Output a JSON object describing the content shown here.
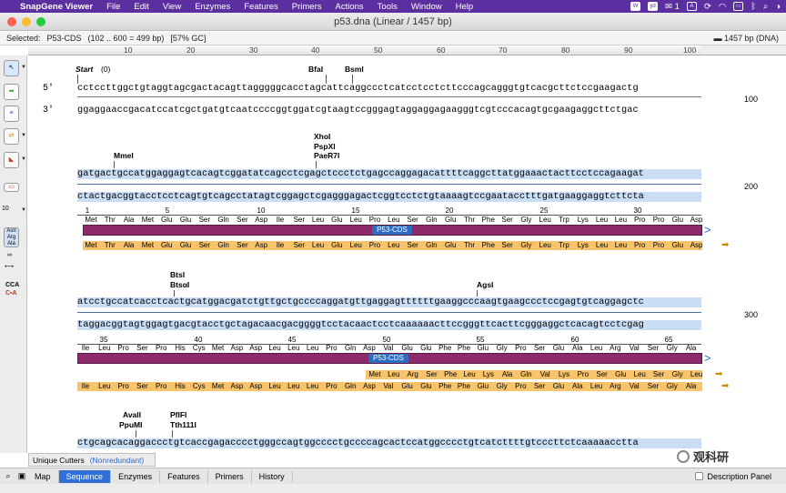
{
  "menubar": {
    "app_name": "SnapGene Viewer",
    "items": [
      "File",
      "Edit",
      "View",
      "Enzymes",
      "Features",
      "Primers",
      "Actions",
      "Tools",
      "Window",
      "Help"
    ],
    "wechat_count": "1"
  },
  "window": {
    "title": "p53.dna (Linear / 1457 bp)"
  },
  "selection": {
    "label": "Selected:",
    "feature": "P53-CDS",
    "range": "(102 .. 600  =  499 bp)",
    "gc": "[57% GC]",
    "length": "1457 bp  (DNA)"
  },
  "ruler_ticks": [
    "10",
    "20",
    "30",
    "40",
    "50",
    "60",
    "70",
    "80",
    "90",
    "100"
  ],
  "toolbar": {
    "tools": [
      "select-tool",
      "insert-arrow",
      "reverse-complement",
      "swap-strands",
      "protein-view",
      "feature-map"
    ],
    "enzyme_count": "10",
    "aa_labels": [
      "Asn",
      "Arg",
      "Ala"
    ],
    "infinity": "∞",
    "cca": "CCA"
  },
  "block1": {
    "start_label": "Start",
    "start_index": "(0)",
    "strand5": "5′",
    "strand3": "3′",
    "enzymes": [
      "BfaI",
      "BsmI"
    ],
    "top": "cctccttggctgtaggtagcgactacagttagggggcacctagcattcaggccctcatcctcctcttcccagcagggtgtcacgcttctccgaagactg",
    "bottom": "ggaggaaccgacatccatcgctgatgtcaatccccggtggatcgtaagtccgggagtaggaggagaagggtcgtcccacagtgcgaagaggcttctgac",
    "end": "100"
  },
  "block2": {
    "enzymes": [
      "MmeI",
      "XhoI",
      "PspXI",
      "PaeR7I"
    ],
    "top": "gatgactgccatggaggagtcacagtcggatatcagcctcgagctccctctgagccaggagacattttcaggcttatggaaactacttcctccagaagat",
    "bottom": "ctactgacggtacctcctcagtgtcagcctatagtcggagctcgagggagactcggtcctctgtaaaagtccgaatacctttgatgaaggaggtcttcta",
    "end": "200",
    "aa_numbers": [
      "1",
      "5",
      "10",
      "15",
      "20",
      "25",
      "30"
    ],
    "aa": [
      "Met",
      "Thr",
      "Ala",
      "Met",
      "Glu",
      "Glu",
      "Ser",
      "Gln",
      "Ser",
      "Asp",
      "Ile",
      "Ser",
      "Leu",
      "Glu",
      "Leu",
      "Pro",
      "Leu",
      "Ser",
      "Gln",
      "Glu",
      "Thr",
      "Phe",
      "Ser",
      "Gly",
      "Leu",
      "Trp",
      "Lys",
      "Leu",
      "Leu",
      "Pro",
      "Pro",
      "Glu",
      "Asp"
    ],
    "feature_label": "P53-CDS",
    "orf": [
      "Met",
      "Thr",
      "Ala",
      "Met",
      "Glu",
      "Glu",
      "Ser",
      "Gln",
      "Ser",
      "Asp",
      "Ile",
      "Ser",
      "Leu",
      "Glu",
      "Leu",
      "Pro",
      "Leu",
      "Ser",
      "Gln",
      "Glu",
      "Thr",
      "Phe",
      "Ser",
      "Gly",
      "Leu",
      "Trp",
      "Lys",
      "Leu",
      "Leu",
      "Pro",
      "Pro",
      "Glu",
      "Asp"
    ]
  },
  "block3": {
    "enzymes": [
      "BtsI",
      "BtsαI",
      "AgsI"
    ],
    "top": "atcctgccatcacctcactgcatggacgatctgttgctgccccaggatgttgaggagttttttgaaggcccaagtgaagccctccgagtgtcaggagctc",
    "bottom": "taggacggtagtggagtgacgtacctgctagacaacgacggggtcctacaactcctcaaaaaacttccgggttcacttcgggaggctcacagtcctcgag",
    "end": "300",
    "aa_numbers": [
      "35",
      "40",
      "45",
      "50",
      "55",
      "60",
      "65"
    ],
    "aa": [
      "Ile",
      "Leu",
      "Pro",
      "Ser",
      "Pro",
      "His",
      "Cys",
      "Met",
      "Asp",
      "Asp",
      "Leu",
      "Leu",
      "Leu",
      "Pro",
      "Gln",
      "Asp",
      "Val",
      "Glu",
      "Glu",
      "Phe",
      "Phe",
      "Glu",
      "Gly",
      "Pro",
      "Ser",
      "Glu",
      "Ala",
      "Leu",
      "Arg",
      "Val",
      "Ser",
      "Gly",
      "Ala"
    ],
    "feature_label": "P53-CDS",
    "orf2": [
      "Met",
      "Leu",
      "Arg",
      "Ser",
      "Phe",
      "Leu",
      "Lys",
      "Ala",
      "Gln",
      "Val",
      "Lys",
      "Pro",
      "Ser",
      "Glu",
      "Leu",
      "Ser",
      "Gly",
      "Leu"
    ],
    "orf": [
      "Ile",
      "Leu",
      "Pro",
      "Ser",
      "Pro",
      "His",
      "Cys",
      "Met",
      "Asp",
      "Asp",
      "Leu",
      "Leu",
      "Leu",
      "Pro",
      "Gln",
      "Asp",
      "Val",
      "Glu",
      "Glu",
      "Phe",
      "Phe",
      "Glu",
      "Gly",
      "Pro",
      "Ser",
      "Glu",
      "Ala",
      "Leu",
      "Arg",
      "Val",
      "Ser",
      "Gly",
      "Ala"
    ]
  },
  "block4": {
    "enzymes": [
      "AvaII",
      "PpuMI",
      "PflFI",
      "Tth111I"
    ],
    "top": "ctgcagcacaggaccctgtcaccgagacccctgggccagtggcccctgccccagcactccatggcccctgtcatcttttgtcccttctcaaaaacctta"
  },
  "cutters": {
    "label": "Unique Cutters",
    "mode": "(Nonredundant)"
  },
  "tabs": [
    "Map",
    "Sequence",
    "Enzymes",
    "Features",
    "Primers",
    "History"
  ],
  "active_tab": "Sequence",
  "description_panel": "Description Panel",
  "watermark": "观科研"
}
